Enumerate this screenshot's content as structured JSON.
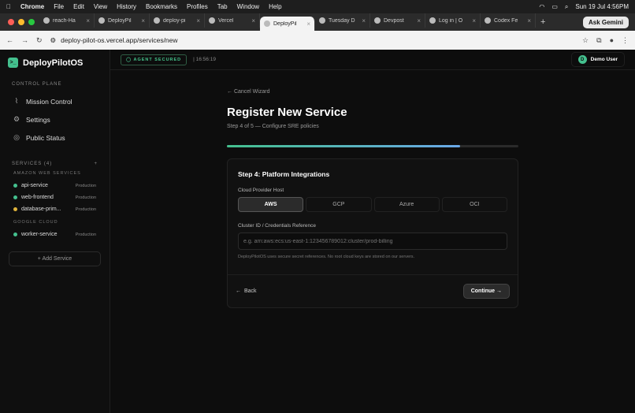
{
  "menubar": {
    "apple": "",
    "app": "Chrome",
    "items": [
      "File",
      "Edit",
      "View",
      "History",
      "Bookmarks",
      "Profiles",
      "Tab",
      "Window",
      "Help"
    ],
    "clock": "Sun 19 Jul  4:56PM"
  },
  "tabs": [
    {
      "title": "reach-Ha"
    },
    {
      "title": "DeployPil"
    },
    {
      "title": "deploy-pi"
    },
    {
      "title": "Vercel"
    },
    {
      "title": "DeployPil",
      "active": true
    },
    {
      "title": "Tuesday D"
    },
    {
      "title": "Devpost"
    },
    {
      "title": "Log in | O"
    },
    {
      "title": "Codex Fe"
    }
  ],
  "ask_gemini": "Ask Gemini",
  "url": "deploy-pilot-os.vercel.app/services/new",
  "brand": "DeployPilotOS",
  "control_plane": "CONTROL PLANE",
  "nav": [
    "Mission Control",
    "Settings",
    "Public Status"
  ],
  "services_header": "SERVICES (4)",
  "add_plus": "+",
  "groups": [
    {
      "name": "AMAZON WEB SERVICES",
      "services": [
        {
          "name": "api-service",
          "env": "Production",
          "color": "#44c08e"
        },
        {
          "name": "web-frontend",
          "env": "Production",
          "color": "#44c08e"
        },
        {
          "name": "database-prim...",
          "env": "Production",
          "color": "#e0b43c"
        }
      ]
    },
    {
      "name": "GOOGLE CLOUD",
      "services": [
        {
          "name": "worker-service",
          "env": "Production",
          "color": "#44c08e"
        }
      ]
    }
  ],
  "add_service": "+ Add Service",
  "agent_badge": "AGENT SECURED",
  "time": "| 16:56:19",
  "user": {
    "initial": "D",
    "name": "Demo User"
  },
  "wizard": {
    "cancel": "← Cancel Wizard",
    "title": "Register New Service",
    "step": "Step 4 of 5 — Configure SRE policies",
    "progress": 0.8,
    "card_title": "Step 4: Platform Integrations",
    "provider_label": "Cloud Provider Host",
    "providers": [
      "AWS",
      "GCP",
      "Azure",
      "OCI"
    ],
    "selected_provider": "AWS",
    "cluster_label": "Cluster ID / Credentials Reference",
    "cluster_placeholder": "e.g. arn:aws:ecs:us-east-1:123456789012:cluster/prod-billing",
    "hint": "DeployPilotOS uses secure secret references. No root cloud keys are stored on our servers.",
    "back": "Back",
    "continue": "Continue →"
  }
}
